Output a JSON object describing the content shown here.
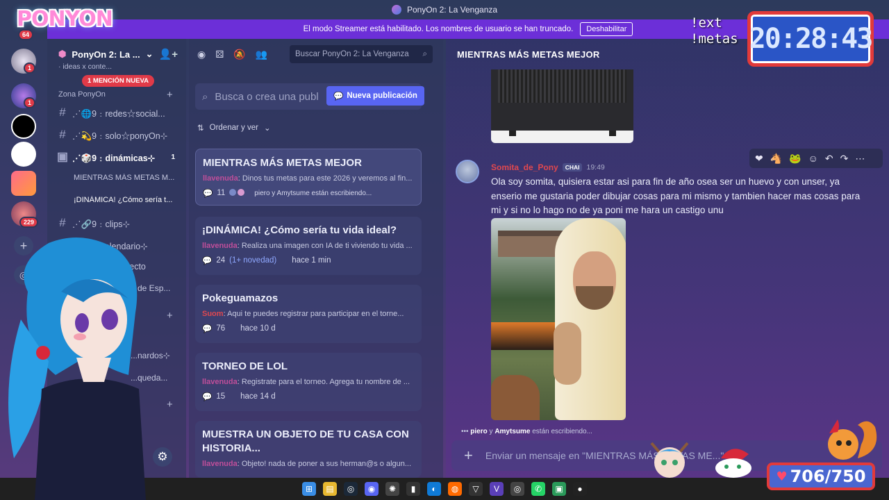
{
  "window": {
    "title": "PonyOn 2: La Venganza"
  },
  "streamer_bar": {
    "text": "El modo Streamer está habilitado. Los nombres de usuario se han truncado.",
    "button": "Deshabilitar"
  },
  "logo_text": "PONYON",
  "rail": {
    "badges": [
      "64",
      "1",
      "1",
      "229"
    ]
  },
  "sidebar": {
    "server_name": "PonyOn 2: La ...",
    "cut_item": "· ideas x conte...",
    "mention_pill": "1 MENCIÓN NUEVA",
    "category": "Zona PonyOn",
    "channels": [
      {
        "label": "⋰🌐9﹕redes☆social...",
        "active": false
      },
      {
        "label": "⋰💫9﹕solo☆ponyOn⊹",
        "active": false
      },
      {
        "label": "⋰🎲9﹕dinámicas⊹",
        "active": true,
        "count": "1"
      }
    ],
    "threads": [
      "MIENTRAS MÁS METAS M...",
      "¡DINÁMICA! ¿Cómo sería t..."
    ],
    "channels2": [
      "⋰🔗9﹕clips⊹",
      "⋰📅﹕calendario⊹",
      "🔴⋰llu: En Directo"
    ],
    "partial": [
      "...de Esp...",
      "...nardos⊹",
      "...queda..."
    ]
  },
  "forum": {
    "search_placeholder": "Buscar PonyOn 2: La Venganza",
    "post_search_placeholder": "Busca o crea una publ",
    "new_post": "Nueva publicación",
    "sort": "Ordenar y ver",
    "posts": [
      {
        "title": "MIENTRAS MÁS METAS MEJOR",
        "author": "llavenuda",
        "preview": "Dinos tus metas para este 2026 y veremos al fin...",
        "count": "11",
        "typing": "piero y Amytsume están escribiendo..."
      },
      {
        "title": "¡DINÁMICA! ¿Cómo sería tu vida ideal?",
        "author": "llavenuda",
        "preview": "Realiza una imagen con IA de ti viviendo tu vida ...",
        "count": "24",
        "new": "(1+ novedad)",
        "time": "hace 1 min"
      },
      {
        "title": "Pokeguamazos",
        "author": "Suom",
        "preview": "Aqui te puedes registrar para participar en el torne...",
        "count": "76",
        "time": "hace 10 d"
      },
      {
        "title": "TORNEO DE LOL",
        "author": "llavenuda",
        "preview": "Registrate para el torneo. Agrega tu nombre de ...",
        "count": "15",
        "time": "hace 14 d"
      },
      {
        "title": "MUESTRA UN OBJETO DE TU CASA CON HISTORIA...",
        "author": "llavenuda",
        "preview": "Objeto! nada de poner a sus herman@s o algun..."
      }
    ]
  },
  "chat": {
    "title": "MIENTRAS MÁS METAS MEJOR",
    "message": {
      "author": "Somita_de_Pony",
      "tag": "CHAI",
      "time": "19:49",
      "text": "Ola soy somita, quisiera estar asi para fin de año osea ser un huevo y con unser, ya enserio me gustaria poder dibujar cosas para mi mismo y tambien hacer mas cosas para mi y si no lo hago no de ya poni me hara un castigo unu"
    },
    "typing": {
      "users": "piero",
      "users2": "Amytsume",
      "text": "están escribiendo..."
    },
    "input_placeholder": "Enviar un mensaje en \"MIENTRAS MÁS METAS ME...\""
  },
  "overlay": {
    "commands": [
      "!ext",
      "!metas"
    ],
    "clock": "20:28:43",
    "goal": "706/750"
  },
  "colors": {
    "streamer_bar": "#6c2fd8",
    "accent": "#5865f2",
    "mention": "#e03a48",
    "author": "#c04e9a"
  }
}
